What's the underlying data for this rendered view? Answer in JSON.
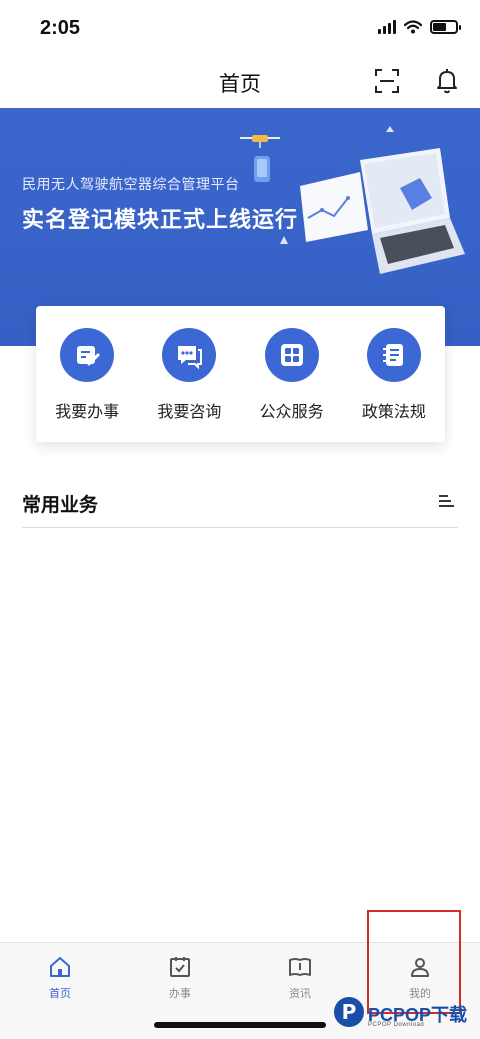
{
  "status_bar": {
    "time": "2:05"
  },
  "nav": {
    "title": "首页",
    "scan_icon": "scan-icon",
    "bell_icon": "bell-icon"
  },
  "banner": {
    "subtitle": "民用无人驾驶航空器综合管理平台",
    "title": "实名登记模块正式上线运行",
    "background": "#3b66cc"
  },
  "quick_actions": [
    {
      "label": "我要办事",
      "icon": "edit-doc-icon"
    },
    {
      "label": "我要咨询",
      "icon": "chat-icon"
    },
    {
      "label": "公众服务",
      "icon": "grid-icon"
    },
    {
      "label": "政策法规",
      "icon": "notebook-icon"
    }
  ],
  "section": {
    "title": "常用业务",
    "menu_icon": "menu-icon"
  },
  "tabs": [
    {
      "label": "首页",
      "icon": "home-icon",
      "active": true
    },
    {
      "label": "办事",
      "icon": "calendar-check-icon",
      "active": false
    },
    {
      "label": "资讯",
      "icon": "book-icon",
      "active": false
    },
    {
      "label": "我的",
      "icon": "person-icon",
      "active": false
    }
  ],
  "watermark": {
    "logo": "P",
    "brand": "PCPOP下载",
    "sub": "PCPOP Download"
  },
  "colors": {
    "accent": "#3b66cc",
    "highlight": "#d42a2a",
    "inactive": "#8a8a8a"
  }
}
